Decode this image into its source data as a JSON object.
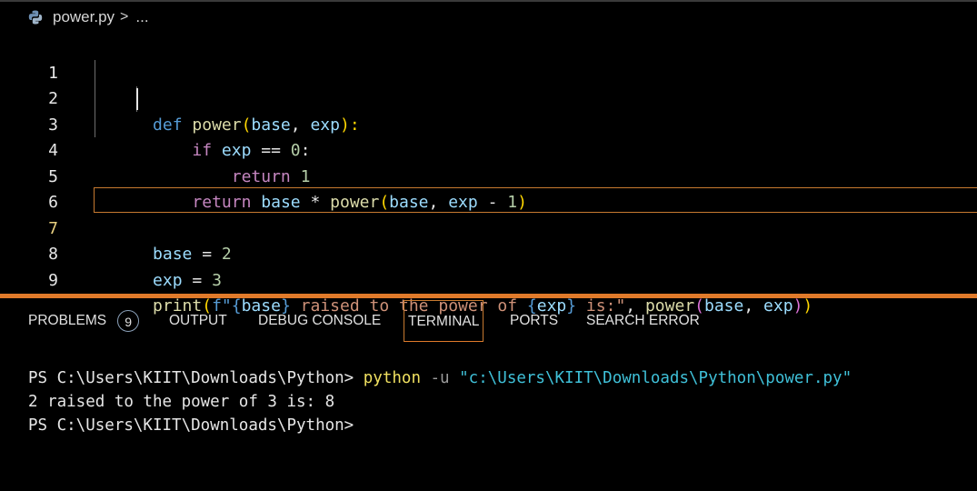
{
  "breadcrumb": {
    "file_name": "power.py",
    "separator": ">",
    "ellipsis": "..."
  },
  "editor": {
    "line_numbers": [
      "1",
      "2",
      "3",
      "4",
      "5",
      "6",
      "7",
      "8",
      "9"
    ],
    "active_line": 7,
    "lines": [
      [
        "def",
        " ",
        "power",
        "(",
        "base",
        ", ",
        "exp",
        "):"
      ],
      [
        "    ",
        "if",
        " ",
        "exp",
        " == ",
        "0",
        ":"
      ],
      [
        "        ",
        "return",
        " ",
        "1"
      ],
      [
        "    ",
        "return",
        " ",
        "base",
        " * ",
        "power",
        "(",
        "base",
        ", ",
        "exp",
        " - ",
        "1",
        ")"
      ],
      [],
      [
        "base",
        " = ",
        "2"
      ],
      [
        "exp",
        " = ",
        "3"
      ],
      [
        "print",
        "(",
        "f\"",
        "{",
        "base",
        "}",
        " raised to the power of ",
        "{",
        "exp",
        "}",
        " is:\"",
        ", ",
        "power",
        "(",
        "base",
        ", ",
        "exp",
        ")",
        ")"
      ],
      []
    ]
  },
  "panel": {
    "tabs": [
      {
        "label": "PROBLEMS",
        "badge": "9"
      },
      {
        "label": "OUTPUT"
      },
      {
        "label": "DEBUG CONSOLE"
      },
      {
        "label": "TERMINAL"
      },
      {
        "label": "PORTS"
      },
      {
        "label": "SEARCH ERROR"
      }
    ],
    "active_tab": "TERMINAL"
  },
  "terminal": {
    "prompt1": "PS C:\\Users\\KIIT\\Downloads\\Python> ",
    "cmd": "python",
    "flag": " -u ",
    "path": "\"c:\\Users\\KIIT\\Downloads\\Python\\power.py\"",
    "output": "2 raised to the power of 3 is: 8",
    "prompt2": "PS C:\\Users\\KIIT\\Downloads\\Python>"
  },
  "colors": {
    "accent": "#e07a2a",
    "keyword": "#569cd6",
    "control": "#c586c0",
    "function": "#dcdcaa",
    "variable": "#9cdcfe",
    "number": "#b5cea8",
    "string": "#ce9178"
  }
}
